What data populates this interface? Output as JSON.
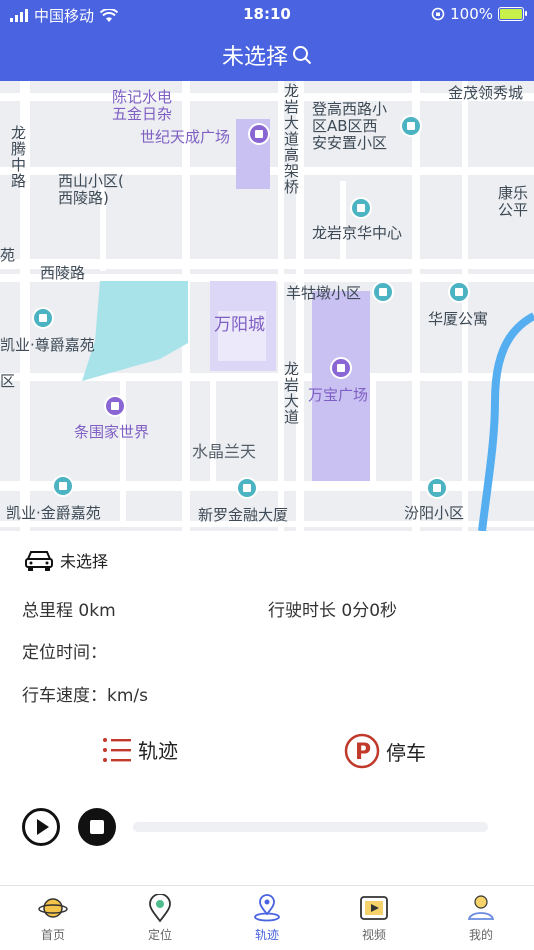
{
  "status": {
    "carrier": "中国移动",
    "time": "18:10",
    "battery": "100%"
  },
  "header": {
    "title": "未选择"
  },
  "map": {
    "labels": {
      "chenji": "陈记水电\n五金日杂",
      "shiji": "世纪天成广场",
      "longteng": "龙腾中路",
      "xishan": "西山小区(\n西陵路)",
      "yuan": "苑",
      "xilinglu": "西陵路",
      "kaiye_zunjue": "凯业·尊爵嘉苑",
      "qu": "区",
      "tiaowei": "条围家世界",
      "kaiye_jinjue": "凯业·金爵嘉苑",
      "longyan_gaojia": "龙岩大道高架桥",
      "denggao": "登高西路小\n区AB区西\n安安置小区",
      "jinmao": "金茂领秀城",
      "kangle": "康乐\n公平",
      "jinghua": "龙岩京华中心",
      "yangguadun": "羊牯墩小区",
      "huaxia": "华厦公寓",
      "wanyang": "万阳城",
      "longyan_dadao": "龙岩大道",
      "wanbao": "万宝广场",
      "shuijing": "水晶兰天",
      "xinluo": "新罗金融大厦",
      "fenyang": "汾阳小区"
    }
  },
  "panel": {
    "vehicle": "未选择",
    "mileage": "总里程 0km",
    "duration": "行驶时长 0分0秒",
    "locate_time": "定位时间：",
    "speed": "行车速度：km/s",
    "track_label": "轨迹",
    "parking_label": "停车"
  },
  "tabs": [
    {
      "label": "首页",
      "icon": "planet-icon"
    },
    {
      "label": "定位",
      "icon": "location-pin-icon"
    },
    {
      "label": "轨迹",
      "icon": "track-pin-icon"
    },
    {
      "label": "视频",
      "icon": "video-icon"
    },
    {
      "label": "我的",
      "icon": "user-icon"
    }
  ],
  "colors": {
    "primary": "#4a63e0",
    "accent_red": "#c0392b",
    "map_bg": "#eceef2",
    "water": "#a9e3ea",
    "river": "#55aef0",
    "mall": "#c9c1f2"
  }
}
